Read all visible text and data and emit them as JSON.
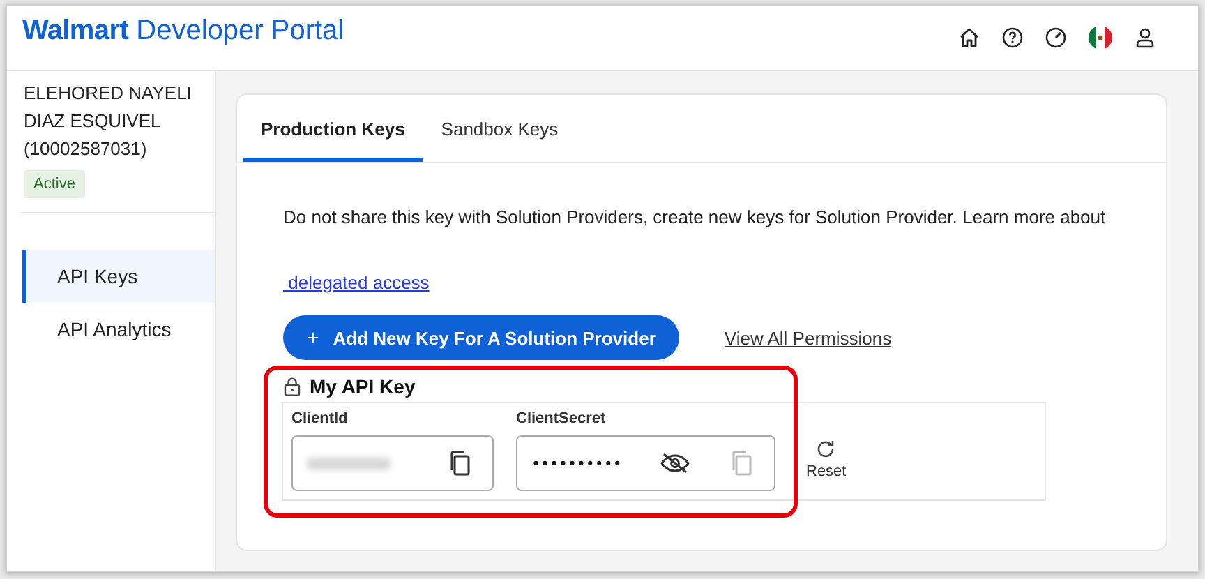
{
  "header": {
    "brand": "Walmart",
    "title": "Developer Portal"
  },
  "sidebar": {
    "account_name": "ELEHORED NAYELI DIAZ ESQUIVEL (10002587031)",
    "status": "Active",
    "items": [
      {
        "label": "API Keys",
        "selected": true
      },
      {
        "label": "API Analytics",
        "selected": false
      }
    ]
  },
  "tabs": [
    {
      "label": "Production Keys",
      "selected": true
    },
    {
      "label": "Sandbox Keys",
      "selected": false
    }
  ],
  "notice": "Do not share this key with Solution Providers, create new keys for Solution Provider. Learn more about",
  "notice_link": " delegated access",
  "add_button": "Add New Key For A Solution Provider",
  "add_button_icon": "+",
  "permissions_link": "View All Permissions",
  "api_key": {
    "title": "My API Key",
    "highlighted": true,
    "fields": [
      {
        "label": "ClientId",
        "kind": "id",
        "value_blurred": true
      },
      {
        "label": "ClientSecret",
        "kind": "secret",
        "value": "••••••••••"
      }
    ],
    "reset": "Reset"
  }
}
